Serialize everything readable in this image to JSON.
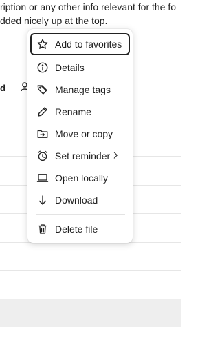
{
  "background": {
    "description_line1": "ription or any other info relevant for the fo",
    "description_line2": "dded nicely up at the top.",
    "column_fragment": "d"
  },
  "menu": {
    "items": [
      {
        "label": "Add to favorites",
        "icon": "star-icon"
      },
      {
        "label": "Details",
        "icon": "info-icon"
      },
      {
        "label": "Manage tags",
        "icon": "tag-icon"
      },
      {
        "label": "Rename",
        "icon": "pencil-icon"
      },
      {
        "label": "Move or copy",
        "icon": "folder-move-icon"
      },
      {
        "label": "Set reminder",
        "icon": "alarm-icon"
      },
      {
        "label": "Open locally",
        "icon": "laptop-icon"
      },
      {
        "label": "Download",
        "icon": "arrow-down-icon"
      }
    ],
    "delete_label": "Delete file",
    "delete_icon": "trash-icon"
  }
}
